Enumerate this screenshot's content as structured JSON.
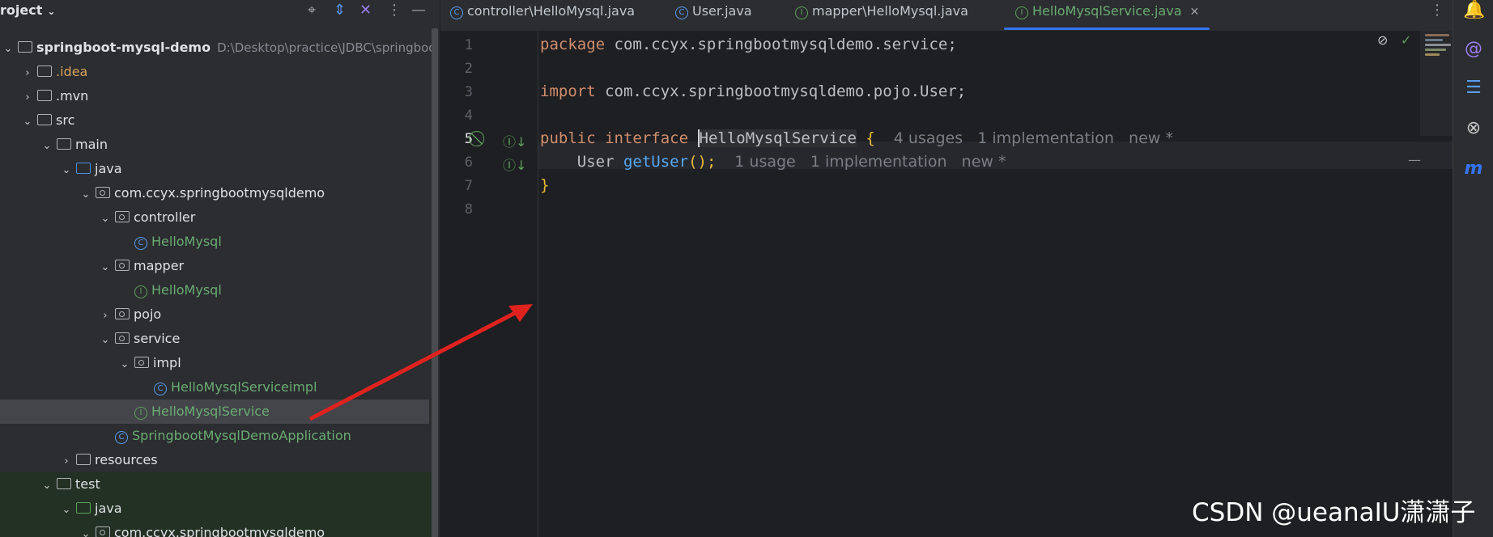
{
  "project_panel": {
    "title": "roject",
    "tree": [
      {
        "label": "springboot-mysql-demo",
        "suffix": "D:\\Desktop\\practice\\JDBC\\springboo",
        "indent": 0,
        "arrow": "⌄",
        "icon": "module-folder",
        "bold": true
      },
      {
        "label": ".idea",
        "indent": 1,
        "arrow": "›",
        "icon": "folder",
        "color": "orange"
      },
      {
        "label": ".mvn",
        "indent": 1,
        "arrow": "›",
        "icon": "folder"
      },
      {
        "label": "src",
        "indent": 1,
        "arrow": "⌄",
        "icon": "folder"
      },
      {
        "label": "main",
        "indent": 2,
        "arrow": "⌄",
        "icon": "folder"
      },
      {
        "label": "java",
        "indent": 3,
        "arrow": "⌄",
        "icon": "source-folder"
      },
      {
        "label": "com.ccyx.springbootmysqldemo",
        "indent": 4,
        "arrow": "⌄",
        "icon": "package"
      },
      {
        "label": "controller",
        "indent": 5,
        "arrow": "⌄",
        "icon": "package"
      },
      {
        "label": "HelloMysql",
        "indent": 6,
        "arrow": "",
        "icon": "class",
        "color": "green"
      },
      {
        "label": "mapper",
        "indent": 5,
        "arrow": "⌄",
        "icon": "package"
      },
      {
        "label": "HelloMysql",
        "indent": 6,
        "arrow": "",
        "icon": "interface",
        "color": "green"
      },
      {
        "label": "pojo",
        "indent": 5,
        "arrow": "›",
        "icon": "package"
      },
      {
        "label": "service",
        "indent": 5,
        "arrow": "⌄",
        "icon": "package"
      },
      {
        "label": "impl",
        "indent": 6,
        "arrow": "⌄",
        "icon": "package"
      },
      {
        "label": "HelloMysqlServiceimpl",
        "indent": 7,
        "arrow": "",
        "icon": "class",
        "color": "green"
      },
      {
        "label": "HelloMysqlService",
        "indent": 6,
        "arrow": "",
        "icon": "interface",
        "color": "green",
        "selected": true
      },
      {
        "label": "SpringbootMysqlDemoApplication",
        "indent": 5,
        "arrow": "",
        "icon": "spring-class",
        "color": "green"
      },
      {
        "label": "resources",
        "indent": 3,
        "arrow": "›",
        "icon": "resources-folder"
      },
      {
        "label": "test",
        "indent": 2,
        "arrow": "⌄",
        "icon": "folder",
        "test": true
      },
      {
        "label": "java",
        "indent": 3,
        "arrow": "⌄",
        "icon": "test-folder",
        "test": true
      },
      {
        "label": "com.ccyx.springbootmysqldemo",
        "indent": 4,
        "arrow": "⌄",
        "icon": "package",
        "test": true
      }
    ]
  },
  "tabs": [
    {
      "label": "controller\\HelloMysql.java",
      "icon": "class-icon",
      "badge": "C"
    },
    {
      "label": "User.java",
      "icon": "class-icon",
      "badge": "C"
    },
    {
      "label": "mapper\\HelloMysql.java",
      "icon": "interface-icon",
      "badge": "I"
    },
    {
      "label": "HelloMysqlService.java",
      "icon": "interface-icon",
      "badge": "I",
      "active": true,
      "close": "✕"
    }
  ],
  "editor": {
    "line_numbers": [
      "1",
      "2",
      "3",
      "4",
      "5",
      "6",
      "7",
      "8"
    ],
    "lines": {
      "l1_kw": "package",
      "l1_rest": " com.ccyx.springbootmysqldemo.service;",
      "l3_kw": "import",
      "l3_rest": " com.ccyx.springbootmysqldemo.pojo.User;",
      "l5_kw1": "public",
      "l5_kw2": "interface",
      "l5_name": "HelloMysqlService",
      "l5_brace": "{",
      "l5_hint": "4 usages   1 implementation   new *",
      "l6_type": "User",
      "l6_fn": "getUser",
      "l6_paren": "();",
      "l6_hint": "1 usage   1 implementation   new *",
      "l7_brace": "}"
    }
  },
  "watermark": "CSDN @ueanaIU潇潇子",
  "colors": {
    "accent": "#3574f0",
    "arrow": "#e0221f",
    "interface_green": "#5fa05c"
  }
}
